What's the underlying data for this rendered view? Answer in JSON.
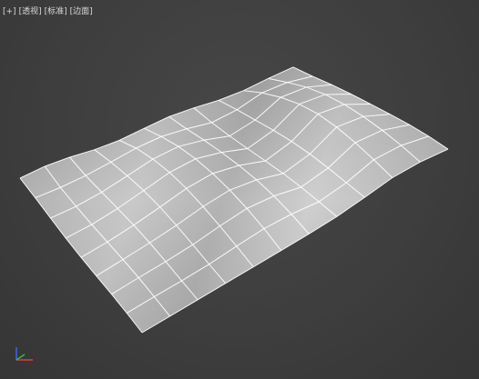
{
  "viewport": {
    "labels": {
      "plus": "[+]",
      "view": "[透视]",
      "shading": "[标准]",
      "edges": "[边面]"
    },
    "background_color": "#3f3f3f",
    "mesh": {
      "fill_color": "#bdbdbd",
      "wire_color": "#ffffff",
      "rows": 8,
      "cols": 11
    },
    "gizmo": {
      "axis_colors": {
        "x": "#e23b3b",
        "y": "#39c039",
        "z": "#3f6cf0"
      }
    }
  }
}
